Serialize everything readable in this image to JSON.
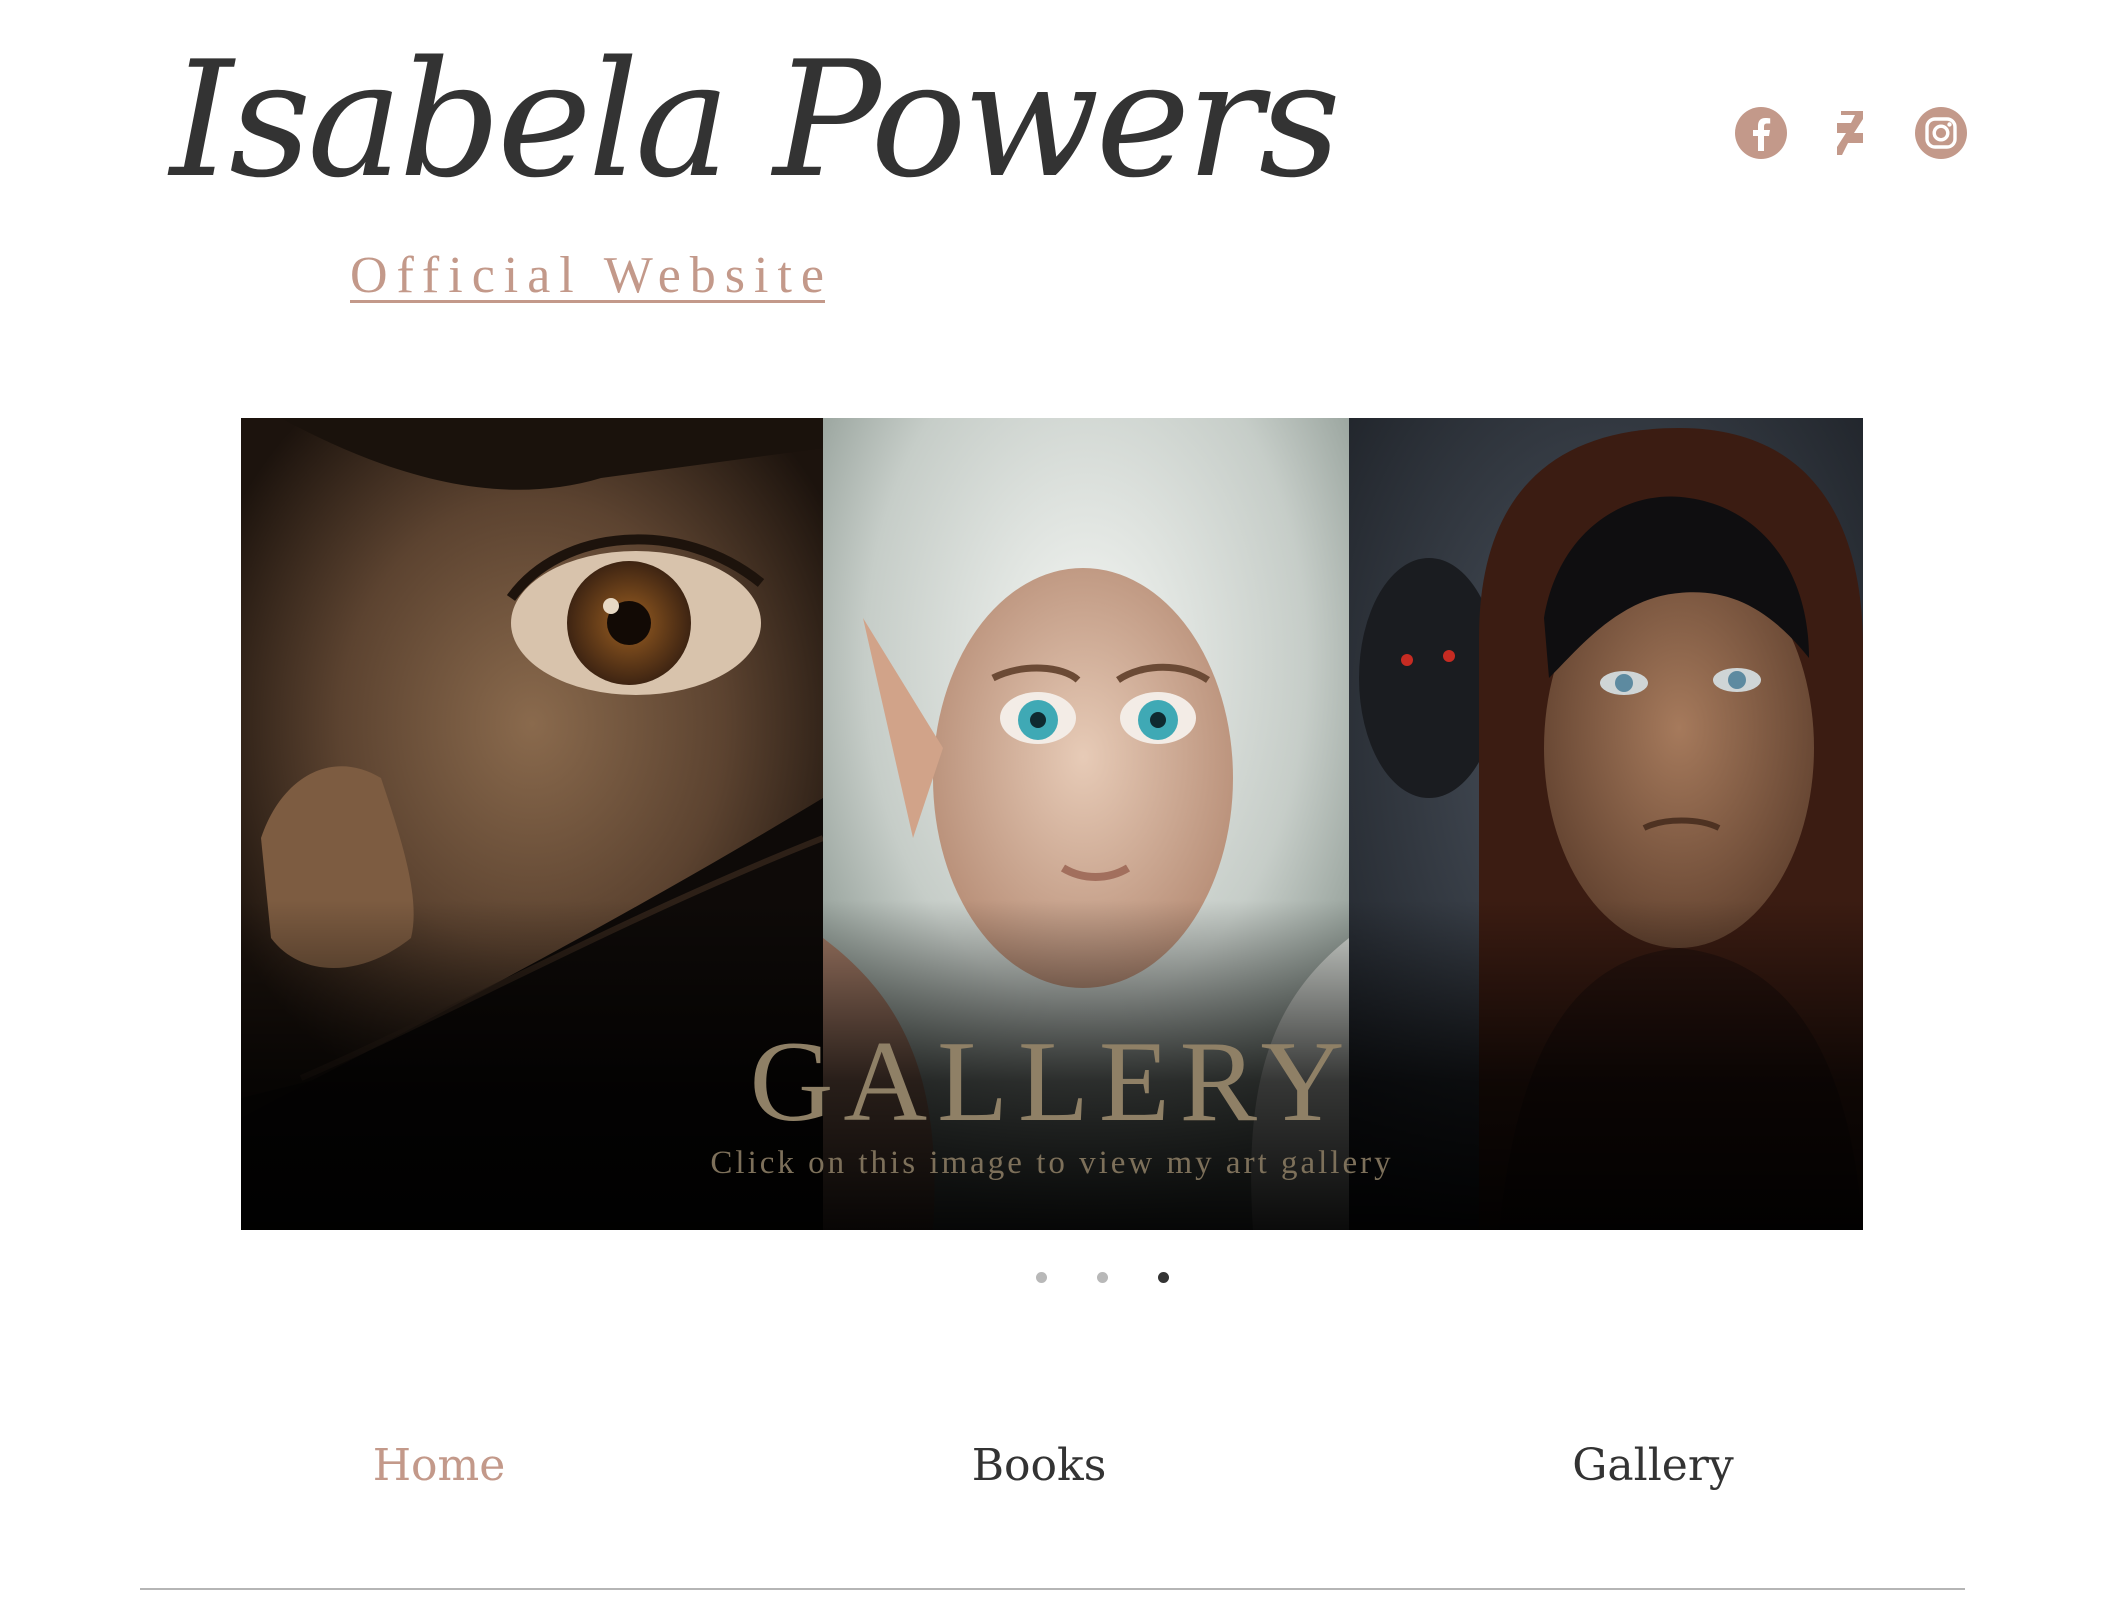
{
  "header": {
    "logo_name": "Isabela Powers",
    "logo_tagline": "Official Website",
    "social": [
      {
        "name": "facebook",
        "icon": "facebook-icon"
      },
      {
        "name": "deviantart",
        "icon": "deviantart-icon"
      },
      {
        "name": "instagram",
        "icon": "instagram-icon"
      }
    ]
  },
  "slider": {
    "title": "GALLERY",
    "subtitle": "Click on this image to view my art gallery",
    "slide_count": 3,
    "active_slide": 3
  },
  "nav": {
    "items": [
      {
        "label": "Home",
        "active": true
      },
      {
        "label": "Books",
        "active": false
      },
      {
        "label": "Gallery",
        "active": false
      }
    ]
  },
  "colors": {
    "accent": "#c3998a",
    "text": "#333333",
    "dot_inactive": "#b8b8b8",
    "dot_active": "#333333"
  }
}
